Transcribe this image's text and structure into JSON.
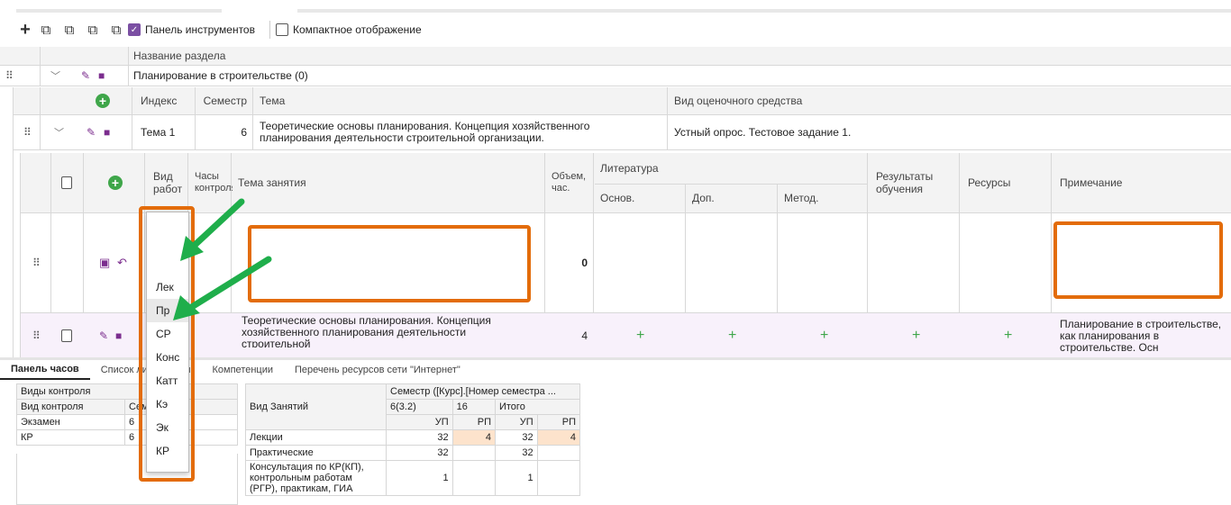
{
  "toolbar": {
    "show_toolbar_label": "Панель инструментов",
    "compact_view_label": "Компактное отображение",
    "show_toolbar_checked": true,
    "compact_view_checked": false
  },
  "section_table": {
    "header": "Название раздела",
    "row_title": "Планирование в строительстве (0)"
  },
  "topic_table": {
    "headers": {
      "index": "Индекс",
      "semester": "Семестр",
      "topic": "Тема",
      "assessment": "Вид оценочного средства"
    },
    "row": {
      "index": "Тема 1",
      "semester": "6",
      "topic": "Теоретические основы планирования. Концепция хозяйственного планирования деятельности строительной организации.",
      "assessment": "Устный опрос. Тестовое задание 1."
    }
  },
  "lesson_table": {
    "headers": {
      "work_type": "Вид работ",
      "control_hours": "Часы контроля",
      "lesson_topic": "Тема занятия",
      "volume": "Объем, час.",
      "literature": "Литература",
      "lit_main": "Основ.",
      "lit_add": "Доп.",
      "lit_method": "Метод.",
      "results": "Результаты обучения",
      "resources": "Ресурсы",
      "note": "Примечание"
    },
    "edit_row": {
      "work_type_value": "Пр",
      "volume": "0"
    },
    "row2": {
      "topic": "Теоретические основы планирования. Концепция хозяйственного планирования деятельности строительной",
      "volume": "4",
      "note": "Планирование в строительстве, как планирования в строительстве. Осн"
    }
  },
  "dropdown": {
    "options": [
      "Лек",
      "Пр",
      "СР",
      "Конс",
      "Катт",
      "Кэ",
      "Эк",
      "КР"
    ],
    "selected": "Пр"
  },
  "bottom_tabs": [
    "Панель часов",
    "Список литературы",
    "Компетенции",
    "Перечень ресурсов сети \"Интернет\""
  ],
  "control_table": {
    "title": "Виды контроля",
    "headers": [
      "Вид контроля",
      "Семестр"
    ],
    "rows": [
      [
        "Экзамен",
        "6"
      ],
      [
        "КР",
        "6"
      ]
    ]
  },
  "hours_table": {
    "header_kind": "Вид Занятий",
    "header_semester": "Семестр ([Курс].[Номер семестра ...",
    "sub_a": "6(3.2)",
    "sub_b": "16",
    "sub_total": "Итого",
    "col_up": "УП",
    "col_rp": "РП",
    "rows": [
      {
        "name": "Лекции",
        "up": "32",
        "rp": "4",
        "tup": "32",
        "trp": "4"
      },
      {
        "name": "Практические",
        "up": "32",
        "rp": "",
        "tup": "32",
        "trp": ""
      },
      {
        "name": "Консультация по КР(КП), контрольным работам (РГР), практикам, ГИА",
        "up": "1",
        "rp": "",
        "tup": "1",
        "trp": ""
      }
    ]
  },
  "colors": {
    "accent": "#7b2d8e",
    "highlight": "#e36c0a",
    "arrow": "#1fae4b",
    "green": "#3fa64a",
    "peach": "#fde3cc"
  }
}
